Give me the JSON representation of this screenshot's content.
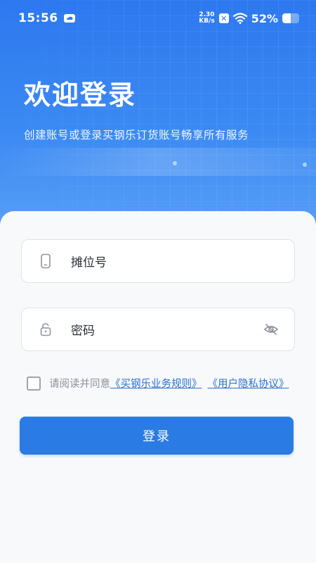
{
  "status_bar": {
    "time": "15:56",
    "net_speed_value": "2.30",
    "net_speed_unit": "KB/s",
    "battery_percent": "52%",
    "battery_level": 0.52
  },
  "header": {
    "title": "欢迎登录",
    "subtitle": "创建账号或登录买钢乐订货账号畅享所有服务"
  },
  "form": {
    "stall_field": {
      "text": "摊位号",
      "icon": "phone-icon"
    },
    "password_field": {
      "text": "密码",
      "icon": "lock-icon",
      "toggle_icon": "eye-off-icon"
    },
    "agreement": {
      "prefix": "请阅读并同意",
      "rules_link": "《买钢乐业务规则》",
      "privacy_link": "《用户隐私协议》",
      "checked": false
    },
    "login_button": "登录"
  },
  "colors": {
    "primary": "#2a7be4",
    "header_top": "#2d78ef",
    "link": "#2d6fcf"
  }
}
